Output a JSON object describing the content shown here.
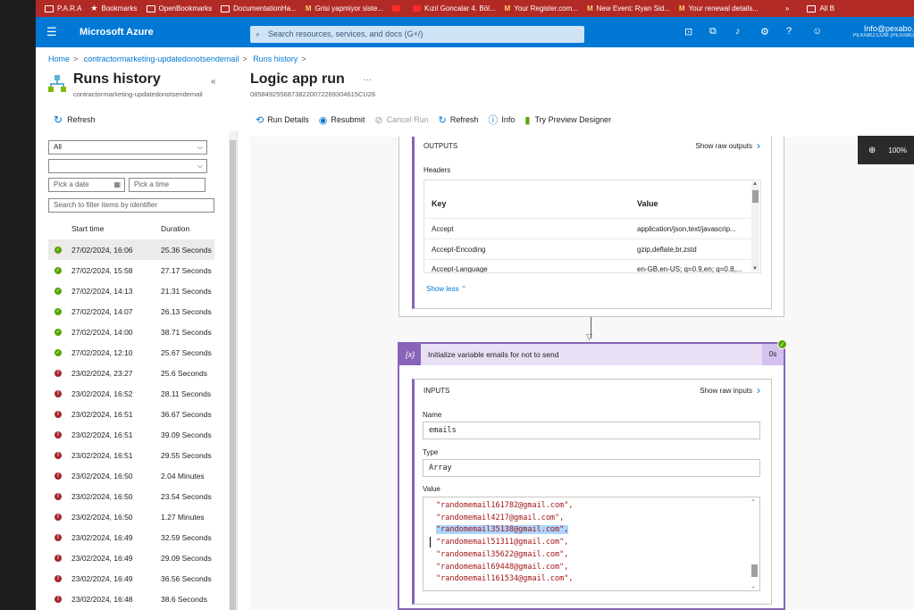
{
  "bookmarks": [
    {
      "icon": "folder-icon",
      "label": "P.A.R.A"
    },
    {
      "icon": "star-icon",
      "label": "Bookmarks"
    },
    {
      "icon": "folder-icon",
      "label": "OpenBookmarks"
    },
    {
      "icon": "folder-icon",
      "label": "DocumentationHa..."
    },
    {
      "icon": "gmail-icon",
      "label": "Grisi yapmiyor siste..."
    },
    {
      "icon": "youtube-icon",
      "label": ""
    },
    {
      "icon": "youtube-icon",
      "label": "Kızıl Goncalar 4. Böl..."
    },
    {
      "icon": "gmail-icon",
      "label": "Your Register.com..."
    },
    {
      "icon": "gmail-icon",
      "label": "New Event: Ryan Sid..."
    },
    {
      "icon": "gmail-icon",
      "label": "Your renewal details..."
    }
  ],
  "bookmarks_more": "»",
  "bookmarks_all": "All B",
  "azure": {
    "brand": "Microsoft Azure",
    "search_placeholder": "Search resources, services, and docs (G+/)",
    "account_email": "Info@pexabo.",
    "account_tenant": "PEXABO.COM (PEXABO"
  },
  "breadcrumb": [
    "Home",
    "contractormarketing-updatedonotsendemail",
    "Runs history"
  ],
  "left": {
    "title": "Runs history",
    "subtitle": "contractormarketing-updatedonotsendemail",
    "refresh": "Refresh",
    "filter_status": "All",
    "filter_second": "",
    "date_placeholder": "Pick a date",
    "time_placeholder": "Pick a time",
    "search_placeholder": "Search to filter items by identifier",
    "col_start": "Start time",
    "col_duration": "Duration",
    "runs": [
      {
        "status": "succeeded",
        "time": "27/02/2024, 16:06",
        "duration": "25.36 Seconds"
      },
      {
        "status": "succeeded",
        "time": "27/02/2024, 15:58",
        "duration": "27.17 Seconds"
      },
      {
        "status": "succeeded",
        "time": "27/02/2024, 14:13",
        "duration": "21.31 Seconds"
      },
      {
        "status": "succeeded",
        "time": "27/02/2024, 14:07",
        "duration": "26.13 Seconds"
      },
      {
        "status": "succeeded",
        "time": "27/02/2024, 14:00",
        "duration": "38.71 Seconds"
      },
      {
        "status": "succeeded",
        "time": "27/02/2024, 12:10",
        "duration": "25.67 Seconds"
      },
      {
        "status": "failed",
        "time": "23/02/2024, 23:27",
        "duration": "25.6 Seconds"
      },
      {
        "status": "failed",
        "time": "23/02/2024, 16:52",
        "duration": "28.11 Seconds"
      },
      {
        "status": "failed",
        "time": "23/02/2024, 16:51",
        "duration": "36.67 Seconds"
      },
      {
        "status": "failed",
        "time": "23/02/2024, 16:51",
        "duration": "39.09 Seconds"
      },
      {
        "status": "failed",
        "time": "23/02/2024, 16:51",
        "duration": "29.55 Seconds"
      },
      {
        "status": "failed",
        "time": "23/02/2024, 16:50",
        "duration": "2.04 Minutes"
      },
      {
        "status": "failed",
        "time": "23/02/2024, 16:50",
        "duration": "23.54 Seconds"
      },
      {
        "status": "failed",
        "time": "23/02/2024, 16:50",
        "duration": "1.27 Minutes"
      },
      {
        "status": "failed",
        "time": "23/02/2024, 16:49",
        "duration": "32.59 Seconds"
      },
      {
        "status": "failed",
        "time": "23/02/2024, 16:49",
        "duration": "29.09 Seconds"
      },
      {
        "status": "failed",
        "time": "23/02/2024, 16:49",
        "duration": "36.56 Seconds"
      },
      {
        "status": "failed",
        "time": "23/02/2024, 16:48",
        "duration": "38.6 Seconds"
      }
    ]
  },
  "run": {
    "title": "Logic app run",
    "more": "···",
    "id": "08584925568738220072269304615CU26",
    "toolbar": {
      "run_details": "Run Details",
      "resubmit": "Resubmit",
      "cancel_run": "Cancel Run",
      "refresh": "Refresh",
      "info": "Info",
      "preview": "Try Preview Designer"
    },
    "zoom": "100%",
    "outputs": {
      "caption": "OUTPUTS",
      "show_raw": "Show raw outputs",
      "headers_label": "Headers",
      "key_col": "Key",
      "value_col": "Value",
      "rows": [
        {
          "key": "Accept",
          "value": "application/json,text/javascrip..."
        },
        {
          "key": "Accept-Encoding",
          "value": "gzip,deflate,br,zstd"
        },
        {
          "key": "Accept-Language",
          "value": "en-GB,en-US; q=0.9,en; q=0.8,..."
        }
      ],
      "show_less": "Show less"
    },
    "init_var": {
      "title": "Initialize variable emails for not to send",
      "duration": "0s",
      "inputs_caption": "INPUTS",
      "show_raw": "Show raw inputs",
      "name_label": "Name",
      "name_value": "emails",
      "type_label": "Type",
      "type_value": "Array",
      "value_label": "Value",
      "value_lines": [
        "\"randomemail161782@gmail.com\",",
        "\"randomemail4217@gmail.com\",",
        "\"randomemail35138@gmail.com\",",
        "\"randomemail51311@gmail.com\",",
        "\"randomemail35622@gmail.com\",",
        "\"randomemail69448@gmail.com\",",
        "\"randomemail161534@gmail.com\","
      ],
      "highlighted_line": 2
    }
  },
  "colors": {
    "azure_blue": "#0078d4",
    "bookmark_bar": "#b22a26",
    "purple": "#8764b8",
    "success": "#57a300",
    "failure": "#a4262c"
  }
}
